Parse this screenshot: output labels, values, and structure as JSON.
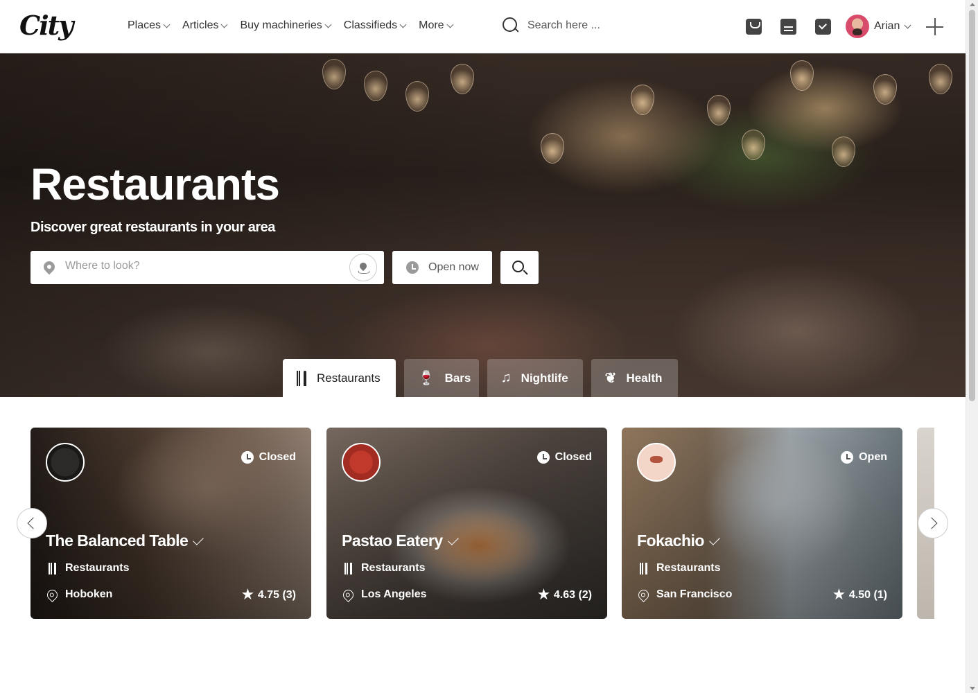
{
  "header": {
    "logo": "City",
    "nav": [
      "Places",
      "Articles",
      "Buy machineries",
      "Classifieds",
      "More"
    ],
    "search_placeholder": "Search here ...",
    "user_name": "Arian"
  },
  "hero": {
    "title": "Restaurants",
    "subtitle": "Discover great restaurants in your area",
    "where_placeholder": "Where to look?",
    "open_now": "Open now",
    "tabs": [
      {
        "label": "Restaurants",
        "icon": "fork-knife-icon"
      },
      {
        "label": "Bars",
        "icon": "glass-icon"
      },
      {
        "label": "Nightlife",
        "icon": "music-note-icon"
      },
      {
        "label": "Health",
        "icon": "leaf-icon"
      }
    ]
  },
  "cards": [
    {
      "title": "The Balanced Table",
      "status": "Closed",
      "category": "Restaurants",
      "location": "Hoboken",
      "rating": "4.75 (3)"
    },
    {
      "title": "Pastao Eatery",
      "status": "Closed",
      "category": "Restaurants",
      "location": "Los Angeles",
      "rating": "4.63 (2)"
    },
    {
      "title": "Fokachio",
      "status": "Open",
      "category": "Restaurants",
      "location": "San Francisco",
      "rating": "4.50 (1)"
    }
  ]
}
